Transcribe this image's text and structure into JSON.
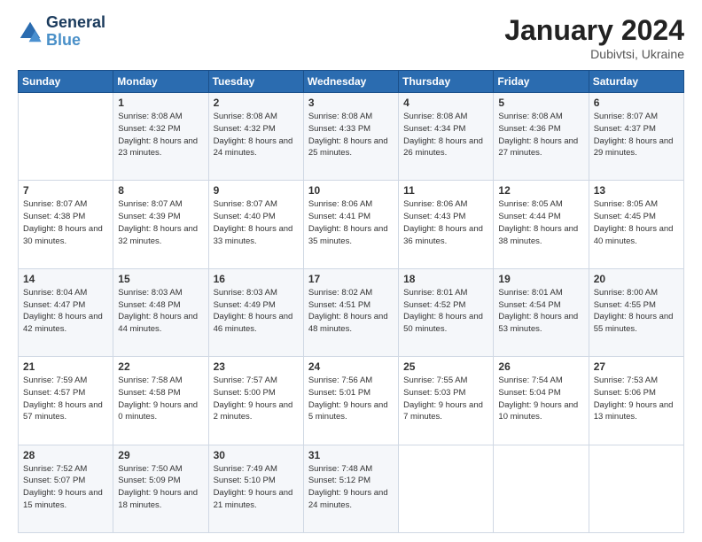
{
  "header": {
    "logo_line1": "General",
    "logo_line2": "Blue",
    "month": "January 2024",
    "location": "Dubivtsi, Ukraine"
  },
  "weekdays": [
    "Sunday",
    "Monday",
    "Tuesday",
    "Wednesday",
    "Thursday",
    "Friday",
    "Saturday"
  ],
  "weeks": [
    [
      {
        "day": "",
        "sunrise": "",
        "sunset": "",
        "daylight": ""
      },
      {
        "day": "1",
        "sunrise": "Sunrise: 8:08 AM",
        "sunset": "Sunset: 4:32 PM",
        "daylight": "Daylight: 8 hours and 23 minutes."
      },
      {
        "day": "2",
        "sunrise": "Sunrise: 8:08 AM",
        "sunset": "Sunset: 4:32 PM",
        "daylight": "Daylight: 8 hours and 24 minutes."
      },
      {
        "day": "3",
        "sunrise": "Sunrise: 8:08 AM",
        "sunset": "Sunset: 4:33 PM",
        "daylight": "Daylight: 8 hours and 25 minutes."
      },
      {
        "day": "4",
        "sunrise": "Sunrise: 8:08 AM",
        "sunset": "Sunset: 4:34 PM",
        "daylight": "Daylight: 8 hours and 26 minutes."
      },
      {
        "day": "5",
        "sunrise": "Sunrise: 8:08 AM",
        "sunset": "Sunset: 4:36 PM",
        "daylight": "Daylight: 8 hours and 27 minutes."
      },
      {
        "day": "6",
        "sunrise": "Sunrise: 8:07 AM",
        "sunset": "Sunset: 4:37 PM",
        "daylight": "Daylight: 8 hours and 29 minutes."
      }
    ],
    [
      {
        "day": "7",
        "sunrise": "Sunrise: 8:07 AM",
        "sunset": "Sunset: 4:38 PM",
        "daylight": "Daylight: 8 hours and 30 minutes."
      },
      {
        "day": "8",
        "sunrise": "Sunrise: 8:07 AM",
        "sunset": "Sunset: 4:39 PM",
        "daylight": "Daylight: 8 hours and 32 minutes."
      },
      {
        "day": "9",
        "sunrise": "Sunrise: 8:07 AM",
        "sunset": "Sunset: 4:40 PM",
        "daylight": "Daylight: 8 hours and 33 minutes."
      },
      {
        "day": "10",
        "sunrise": "Sunrise: 8:06 AM",
        "sunset": "Sunset: 4:41 PM",
        "daylight": "Daylight: 8 hours and 35 minutes."
      },
      {
        "day": "11",
        "sunrise": "Sunrise: 8:06 AM",
        "sunset": "Sunset: 4:43 PM",
        "daylight": "Daylight: 8 hours and 36 minutes."
      },
      {
        "day": "12",
        "sunrise": "Sunrise: 8:05 AM",
        "sunset": "Sunset: 4:44 PM",
        "daylight": "Daylight: 8 hours and 38 minutes."
      },
      {
        "day": "13",
        "sunrise": "Sunrise: 8:05 AM",
        "sunset": "Sunset: 4:45 PM",
        "daylight": "Daylight: 8 hours and 40 minutes."
      }
    ],
    [
      {
        "day": "14",
        "sunrise": "Sunrise: 8:04 AM",
        "sunset": "Sunset: 4:47 PM",
        "daylight": "Daylight: 8 hours and 42 minutes."
      },
      {
        "day": "15",
        "sunrise": "Sunrise: 8:03 AM",
        "sunset": "Sunset: 4:48 PM",
        "daylight": "Daylight: 8 hours and 44 minutes."
      },
      {
        "day": "16",
        "sunrise": "Sunrise: 8:03 AM",
        "sunset": "Sunset: 4:49 PM",
        "daylight": "Daylight: 8 hours and 46 minutes."
      },
      {
        "day": "17",
        "sunrise": "Sunrise: 8:02 AM",
        "sunset": "Sunset: 4:51 PM",
        "daylight": "Daylight: 8 hours and 48 minutes."
      },
      {
        "day": "18",
        "sunrise": "Sunrise: 8:01 AM",
        "sunset": "Sunset: 4:52 PM",
        "daylight": "Daylight: 8 hours and 50 minutes."
      },
      {
        "day": "19",
        "sunrise": "Sunrise: 8:01 AM",
        "sunset": "Sunset: 4:54 PM",
        "daylight": "Daylight: 8 hours and 53 minutes."
      },
      {
        "day": "20",
        "sunrise": "Sunrise: 8:00 AM",
        "sunset": "Sunset: 4:55 PM",
        "daylight": "Daylight: 8 hours and 55 minutes."
      }
    ],
    [
      {
        "day": "21",
        "sunrise": "Sunrise: 7:59 AM",
        "sunset": "Sunset: 4:57 PM",
        "daylight": "Daylight: 8 hours and 57 minutes."
      },
      {
        "day": "22",
        "sunrise": "Sunrise: 7:58 AM",
        "sunset": "Sunset: 4:58 PM",
        "daylight": "Daylight: 9 hours and 0 minutes."
      },
      {
        "day": "23",
        "sunrise": "Sunrise: 7:57 AM",
        "sunset": "Sunset: 5:00 PM",
        "daylight": "Daylight: 9 hours and 2 minutes."
      },
      {
        "day": "24",
        "sunrise": "Sunrise: 7:56 AM",
        "sunset": "Sunset: 5:01 PM",
        "daylight": "Daylight: 9 hours and 5 minutes."
      },
      {
        "day": "25",
        "sunrise": "Sunrise: 7:55 AM",
        "sunset": "Sunset: 5:03 PM",
        "daylight": "Daylight: 9 hours and 7 minutes."
      },
      {
        "day": "26",
        "sunrise": "Sunrise: 7:54 AM",
        "sunset": "Sunset: 5:04 PM",
        "daylight": "Daylight: 9 hours and 10 minutes."
      },
      {
        "day": "27",
        "sunrise": "Sunrise: 7:53 AM",
        "sunset": "Sunset: 5:06 PM",
        "daylight": "Daylight: 9 hours and 13 minutes."
      }
    ],
    [
      {
        "day": "28",
        "sunrise": "Sunrise: 7:52 AM",
        "sunset": "Sunset: 5:07 PM",
        "daylight": "Daylight: 9 hours and 15 minutes."
      },
      {
        "day": "29",
        "sunrise": "Sunrise: 7:50 AM",
        "sunset": "Sunset: 5:09 PM",
        "daylight": "Daylight: 9 hours and 18 minutes."
      },
      {
        "day": "30",
        "sunrise": "Sunrise: 7:49 AM",
        "sunset": "Sunset: 5:10 PM",
        "daylight": "Daylight: 9 hours and 21 minutes."
      },
      {
        "day": "31",
        "sunrise": "Sunrise: 7:48 AM",
        "sunset": "Sunset: 5:12 PM",
        "daylight": "Daylight: 9 hours and 24 minutes."
      },
      {
        "day": "",
        "sunrise": "",
        "sunset": "",
        "daylight": ""
      },
      {
        "day": "",
        "sunrise": "",
        "sunset": "",
        "daylight": ""
      },
      {
        "day": "",
        "sunrise": "",
        "sunset": "",
        "daylight": ""
      }
    ]
  ]
}
